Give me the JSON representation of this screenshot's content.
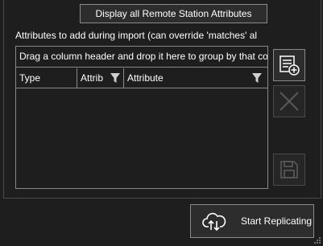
{
  "display_button_label": "Display all Remote Station Attributes",
  "import_section_label": "Attributes to add during import (can override 'matches' al",
  "grid": {
    "group_panel_text": "Drag a column header and drop it here to group by that co",
    "columns": [
      "Type",
      "Attrib",
      "Attribute"
    ]
  },
  "side_buttons": {
    "add_icon": "add-list-icon",
    "remove_icon": "close-icon",
    "save_icon": "save-icon"
  },
  "start_button_label": "Start Replicating",
  "colors": {
    "background": "#1e1e1e",
    "button_bg": "#2d2d2d",
    "border": "#8a8a8a",
    "disabled_icon": "#5a5a5a"
  }
}
